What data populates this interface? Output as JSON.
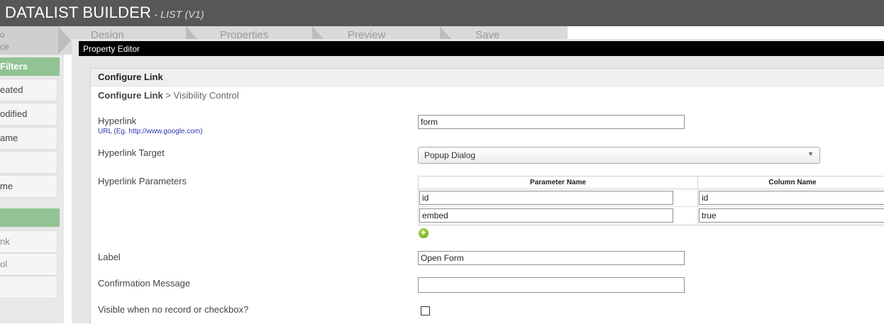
{
  "header": {
    "title": "DATALIST BUILDER",
    "subtitle": "- LIST (V1)"
  },
  "steps": {
    "first_line1": "o",
    "first_line2": "ce",
    "items": [
      "Design",
      "Properties",
      "Preview",
      "Save"
    ]
  },
  "sidebar": {
    "filters_heading": "Filters",
    "filter_items": [
      "eated",
      "odified",
      "ame",
      "",
      "me"
    ],
    "actions_heading": "",
    "action_items": [
      "nk",
      "ol",
      ""
    ]
  },
  "modal": {
    "title": "Property Editor"
  },
  "panel": {
    "title": "Configure Link",
    "breadcrumb": {
      "current": "Configure Link",
      "separator": " > ",
      "next": "Visibility Control"
    }
  },
  "fields": {
    "hyperlink": {
      "label": "Hyperlink",
      "hint": "URL (Eg. http://www.google.com)",
      "value": "form"
    },
    "target": {
      "label": "Hyperlink Target",
      "value": "Popup Dialog"
    },
    "parameters": {
      "label": "Hyperlink Parameters",
      "headers": [
        "Parameter Name",
        "Column Name"
      ],
      "rows": [
        [
          "id",
          "id"
        ],
        [
          "embed",
          "true"
        ]
      ]
    },
    "link_label": {
      "label": "Label",
      "value": "Open Form"
    },
    "confirmation": {
      "label": "Confirmation Message",
      "value": ""
    },
    "visible_no_record": {
      "label": "Visible when no record or checkbox?"
    }
  },
  "icons": {
    "add": "add-circle-icon",
    "dropdown": "chevron-down-icon"
  },
  "colors": {
    "header_bg": "#575757",
    "sidebar_accent": "#91c394",
    "modal_titlebar": "#000000",
    "add_icon": "#7ab829"
  }
}
